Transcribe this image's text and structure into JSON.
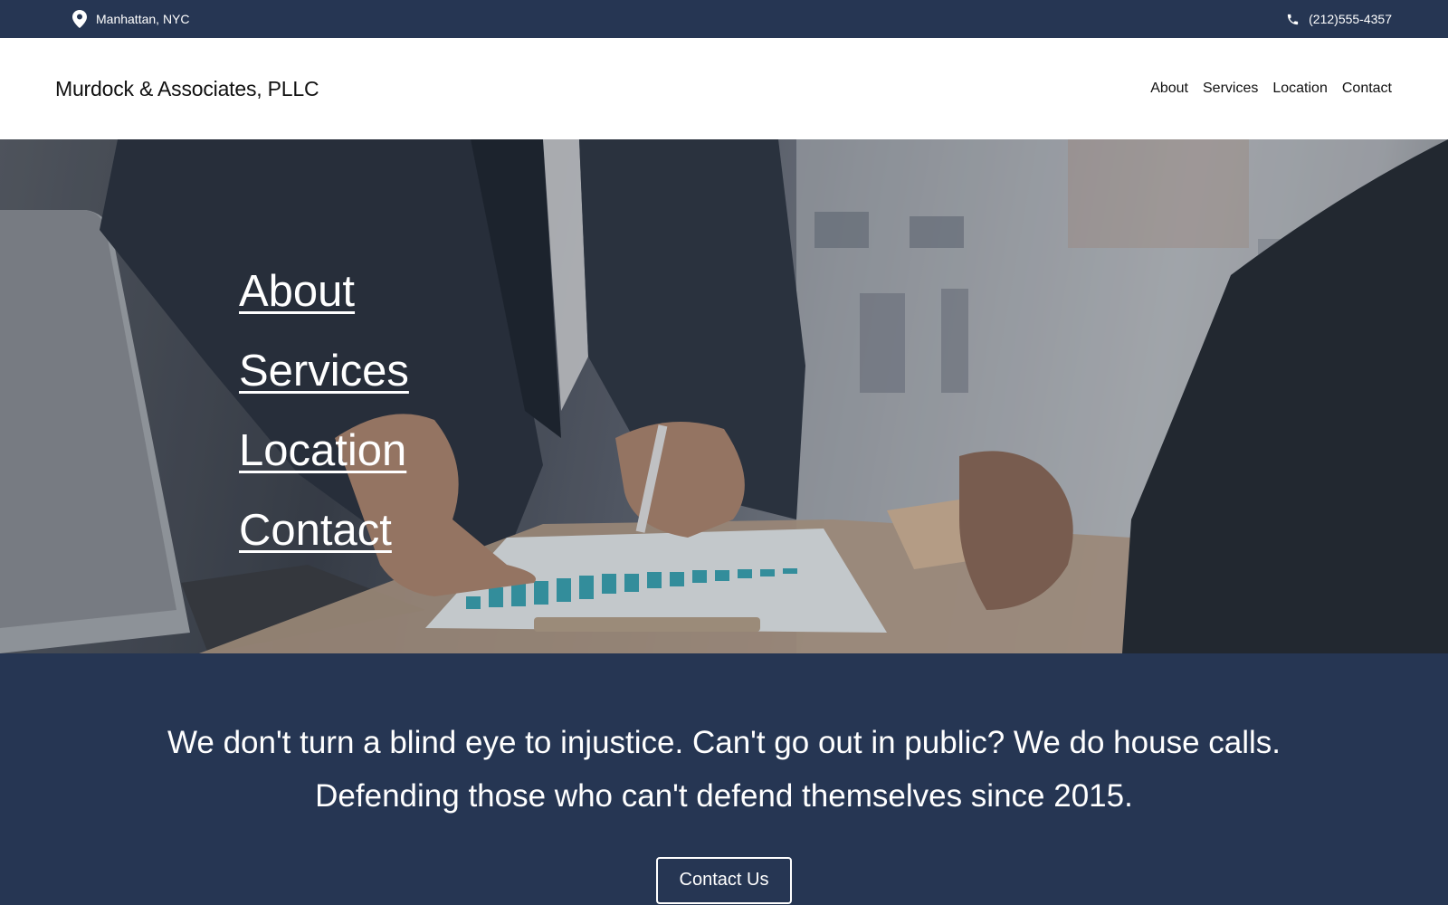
{
  "topbar": {
    "location": "Manhattan, NYC",
    "phone": "(212)555-4357",
    "location_icon": "map-pin-icon",
    "phone_icon": "phone-icon"
  },
  "navbar": {
    "brand": "Murdock & Associates, PLLC",
    "links": [
      "About",
      "Services",
      "Location",
      "Contact"
    ]
  },
  "hero": {
    "image_subject": "business meeting at office desk",
    "links": [
      "About",
      "Services",
      "Location",
      "Contact"
    ]
  },
  "tagline": {
    "line1": "We don't turn a blind eye to injustice. Can't go out in public? We do house calls.",
    "line2": "Defending those who can't defend themselves since 2015.",
    "cta_label": "Contact Us"
  },
  "colors": {
    "navy": "#263653",
    "white": "#ffffff",
    "text_dark": "#111111"
  }
}
